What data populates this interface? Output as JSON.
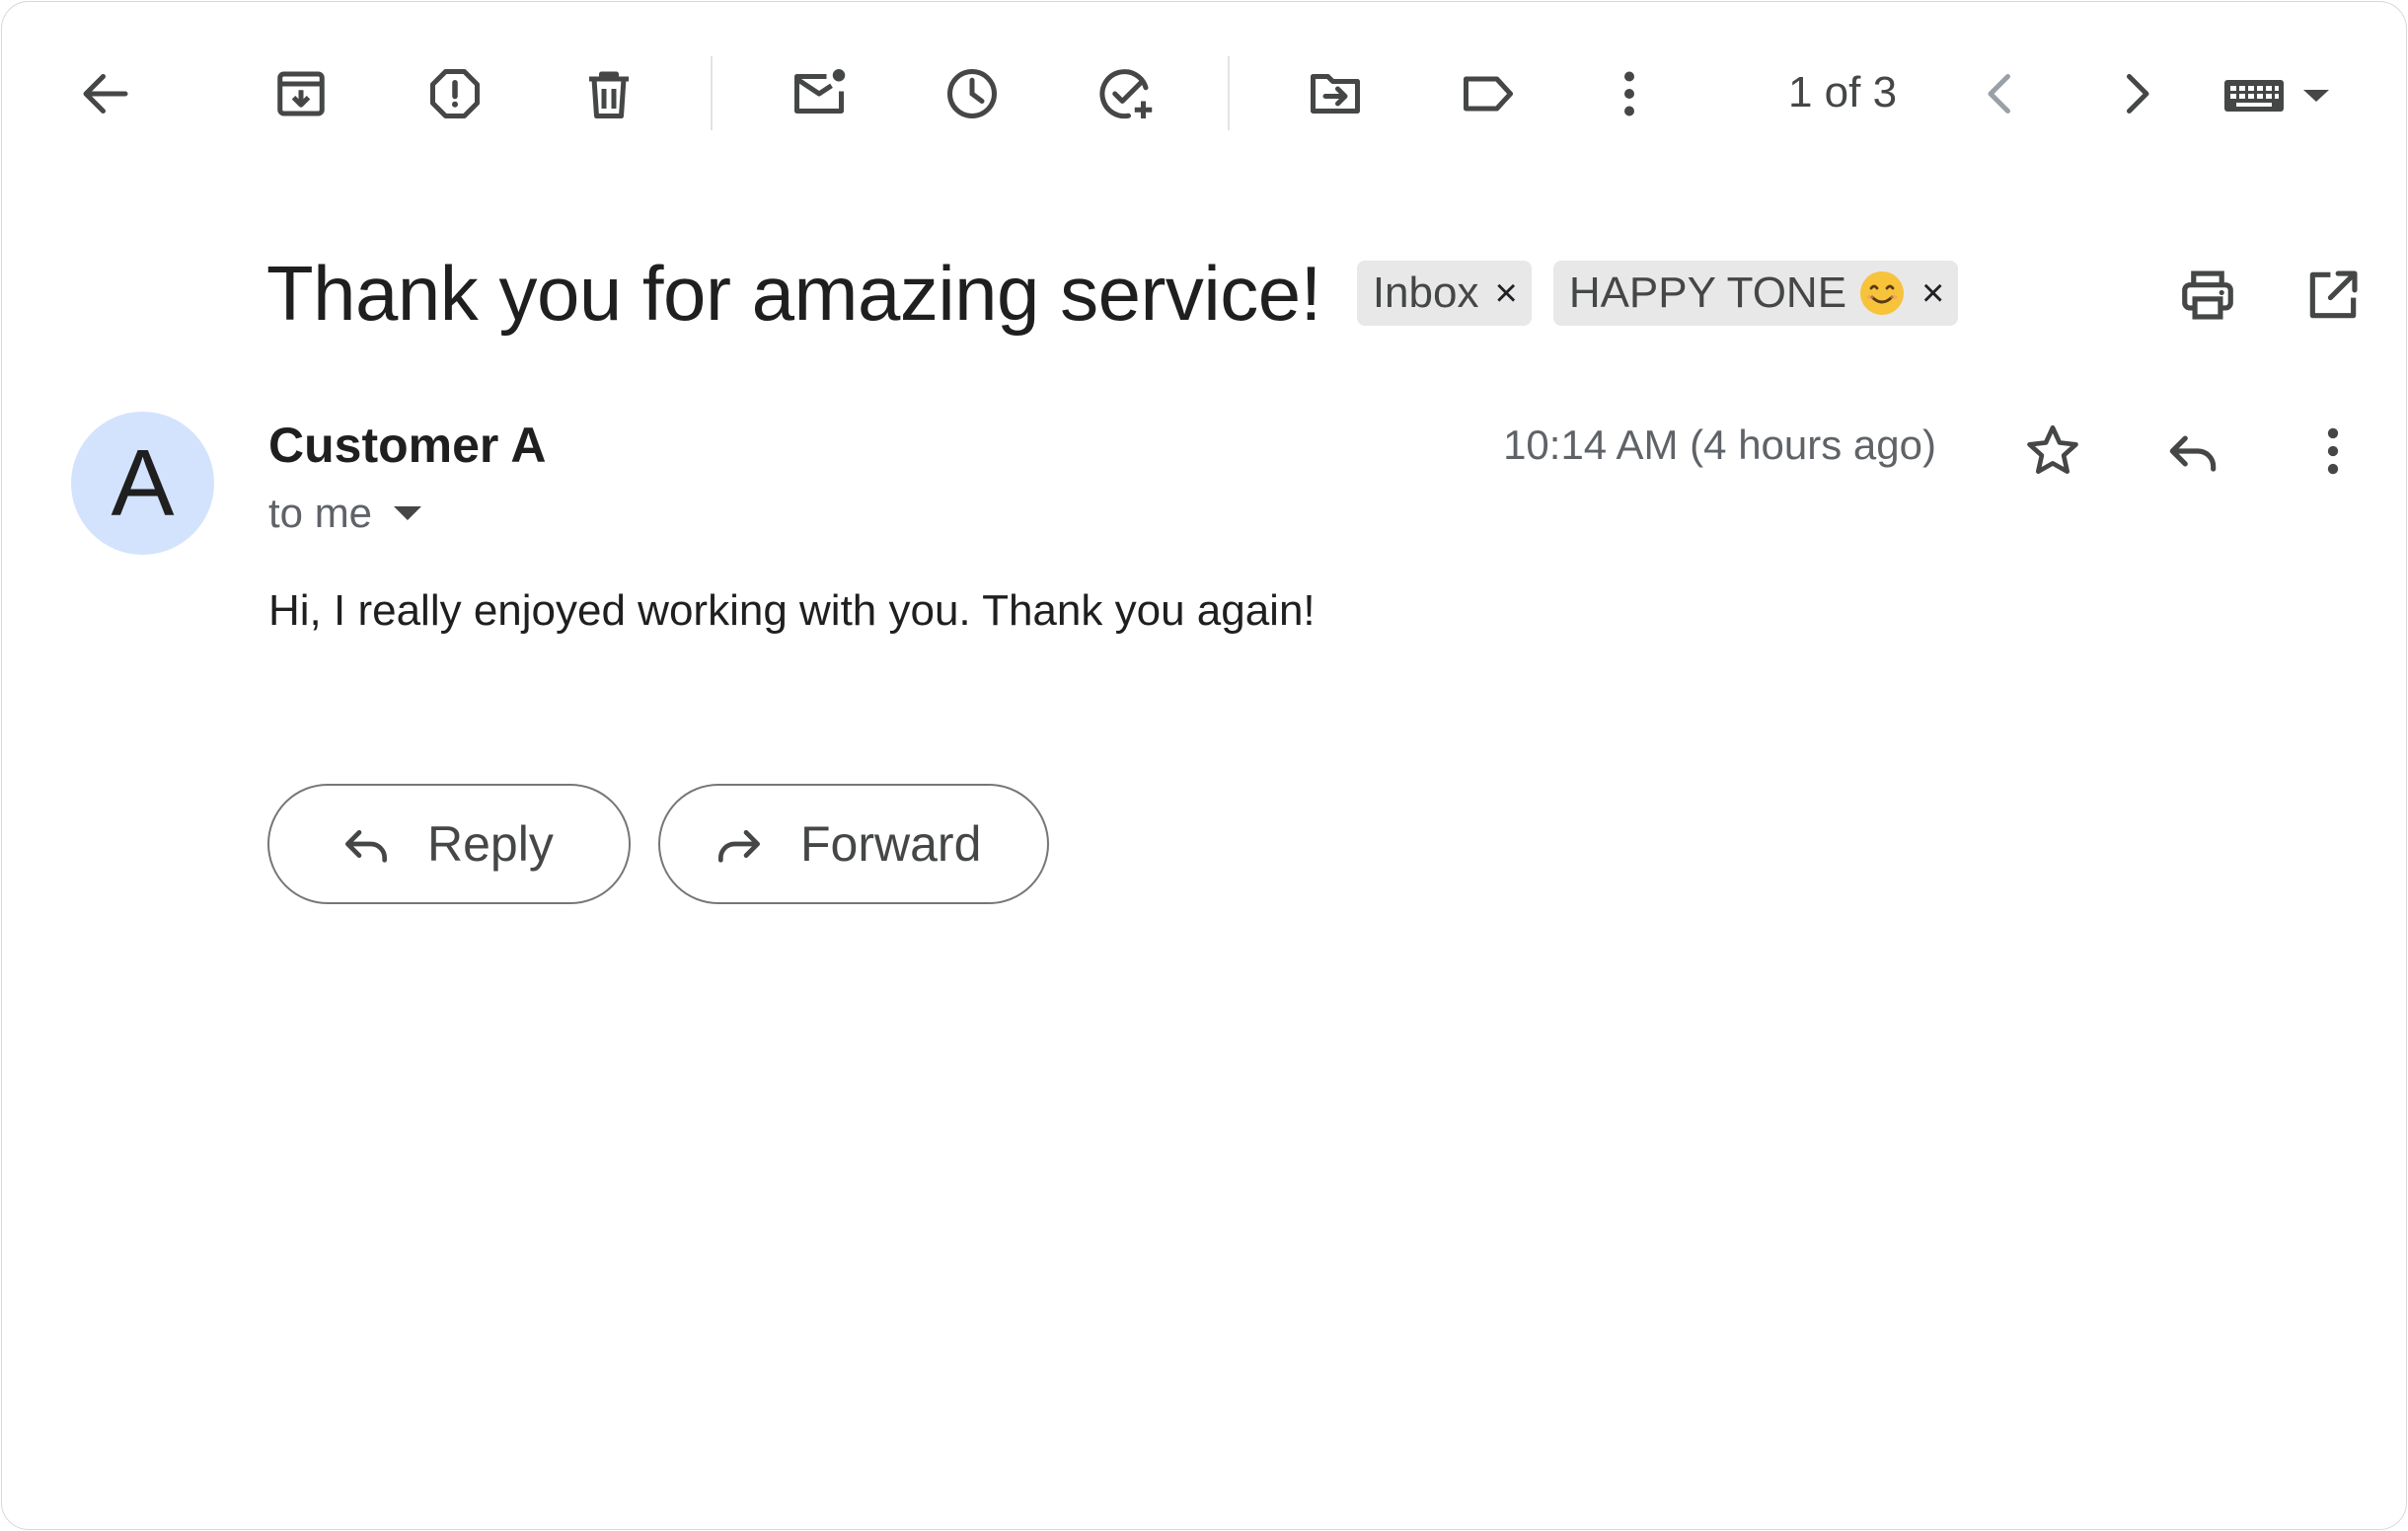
{
  "toolbar": {
    "back": "arrow-left-icon",
    "archive": "archive-icon",
    "report_spam": "report-spam-icon",
    "delete": "trash-icon",
    "mark_unread": "mark-unread-icon",
    "snooze": "clock-icon",
    "add_task": "add-task-icon",
    "move_to": "move-to-folder-icon",
    "labels": "label-icon",
    "more": "more-vert-icon",
    "pager_text": "1 of 3",
    "newer": "chevron-left-icon",
    "older": "chevron-right-icon",
    "input_tools": "keyboard-icon"
  },
  "email": {
    "subject": "Thank you for amazing service!",
    "labels": [
      {
        "name": "Inbox",
        "remove": "×"
      },
      {
        "name": "HAPPY TONE",
        "remove": "×",
        "emoji": "smiling-face-icon"
      }
    ],
    "sender": "Customer A",
    "avatar_letter": "A",
    "recipient_text": "to me",
    "timestamp": "10:14 AM (4 hours ago)",
    "body": "Hi, I really enjoyed working with you. Thank you again!"
  },
  "actions": {
    "reply_label": "Reply",
    "forward_label": "Forward"
  },
  "colors": {
    "avatar_bg": "#d3e3fd",
    "chip_bg": "#e8e8e8",
    "icon": "#444746",
    "disabled_icon": "#9aa0a6",
    "emoji": "#f6c33b"
  }
}
